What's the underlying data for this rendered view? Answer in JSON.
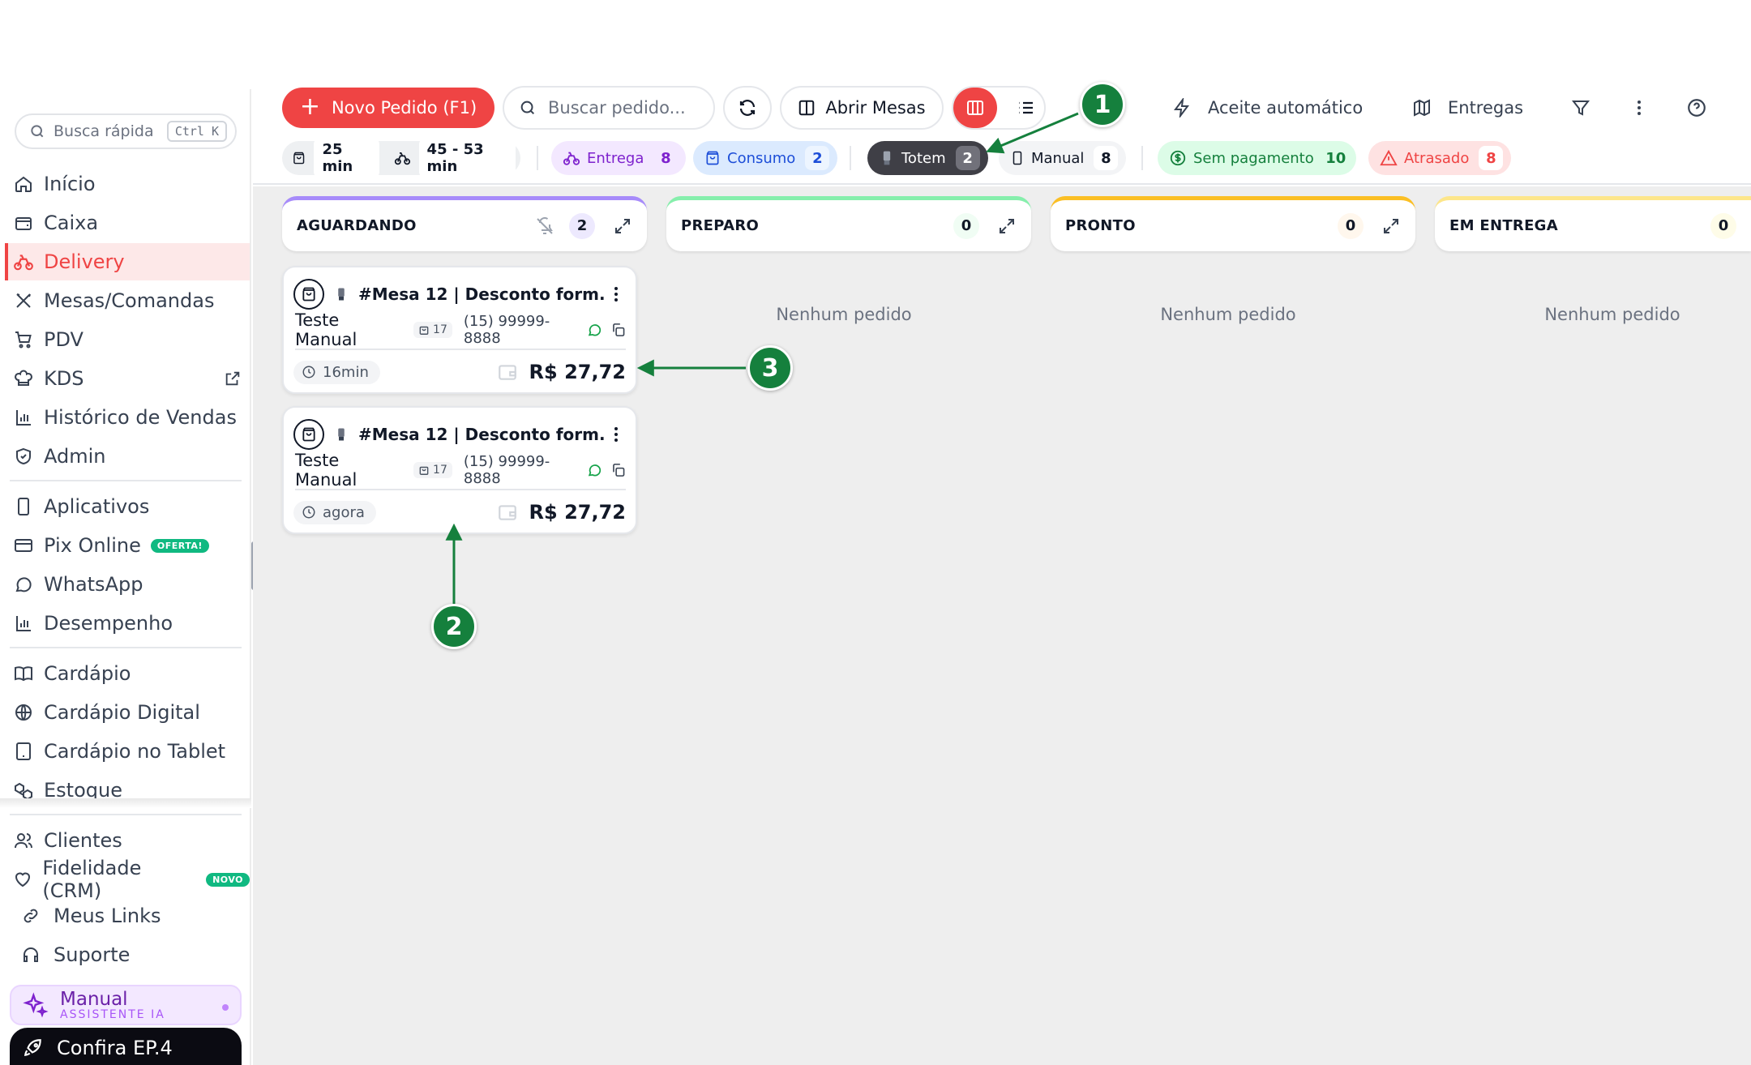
{
  "sidebar": {
    "search_placeholder": "Busca rápida",
    "search_shortcut": "Ctrl K",
    "items": [
      {
        "label": "Início",
        "icon": "home-icon"
      },
      {
        "label": "Caixa",
        "icon": "wallet-icon"
      },
      {
        "label": "Delivery",
        "icon": "bike-icon",
        "active": true
      },
      {
        "label": "Mesas/Comandas",
        "icon": "utensils-icon"
      },
      {
        "label": "PDV",
        "icon": "cart-icon"
      },
      {
        "label": "KDS",
        "icon": "chef-hat-icon"
      },
      {
        "label": "Histórico de Vendas",
        "icon": "bar-chart-icon"
      },
      {
        "label": "Admin",
        "icon": "shield-icon"
      },
      {
        "label": "Aplicativos",
        "icon": "smartphone-icon"
      },
      {
        "label": "Pix Online",
        "icon": "credit-card-icon",
        "badge": "OFERTA!"
      },
      {
        "label": "WhatsApp",
        "icon": "chat-icon"
      },
      {
        "label": "Desempenho",
        "icon": "bar-chart-icon"
      },
      {
        "label": "Cardápio",
        "icon": "book-icon"
      },
      {
        "label": "Cardápio Digital",
        "icon": "globe-icon"
      },
      {
        "label": "Cardápio no Tablet",
        "icon": "tablet-icon"
      },
      {
        "label": "Estoque",
        "icon": "boxes-icon"
      },
      {
        "label": "Clientes",
        "icon": "users-icon"
      },
      {
        "label": "Fidelidade (CRM)",
        "icon": "heart-icon",
        "badge": "NOVO"
      }
    ],
    "sub_items": [
      {
        "label": "Meus Links",
        "icon": "link-icon"
      },
      {
        "label": "Suporte",
        "icon": "headset-icon"
      }
    ],
    "assistant": {
      "title": "Manual",
      "subtitle": "ASSISTENTE IA"
    },
    "episode": "Confira EP.4"
  },
  "toolbar": {
    "new_order": "Novo Pedido (F1)",
    "search_placeholder": "Buscar pedido...",
    "open_tables": "Abrir Mesas",
    "auto_accept": "Aceite automático",
    "deliveries": "Entregas"
  },
  "chips": {
    "prep_time": "25 min",
    "delivery_time": "45 - 53 min",
    "entrega": {
      "label": "Entrega",
      "count": "8"
    },
    "consumo": {
      "label": "Consumo",
      "count": "2"
    },
    "totem": {
      "label": "Totem",
      "count": "2"
    },
    "manual": {
      "label": "Manual",
      "count": "8"
    },
    "sem_pagamento": {
      "label": "Sem pagamento",
      "count": "10"
    },
    "atrasado": {
      "label": "Atrasado",
      "count": "8"
    }
  },
  "columns": [
    {
      "name": "AGUARDANDO",
      "count": "2",
      "color": "#a78bfa"
    },
    {
      "name": "PREPARO",
      "count": "0",
      "color": "#86efac",
      "empty": "Nenhum pedido"
    },
    {
      "name": "PRONTO",
      "count": "0",
      "color": "#fbbf24",
      "empty": "Nenhum pedido"
    },
    {
      "name": "EM ENTREGA",
      "count": "0",
      "color": "#fde68a",
      "empty": "Nenhum pedido"
    }
  ],
  "orders": [
    {
      "title": "#Mesa 12 | Desconto form...",
      "customer": "Teste Manual",
      "items": "17",
      "phone": "(15) 99999-8888",
      "age": "16min",
      "total": "R$ 27,72"
    },
    {
      "title": "#Mesa 12 | Desconto form...",
      "customer": "Teste Manual",
      "items": "17",
      "phone": "(15) 99999-8888",
      "age": "agora",
      "total": "R$ 27,72"
    }
  ],
  "annotations": [
    "1",
    "2",
    "3"
  ],
  "colors": {
    "accent": "#ef4444",
    "marker": "#15803d"
  }
}
